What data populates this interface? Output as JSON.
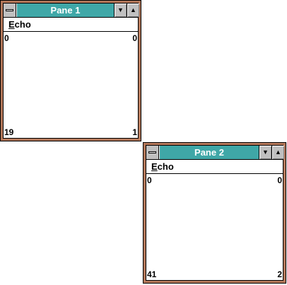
{
  "panes": [
    {
      "title": "Pane 1",
      "menu": {
        "echo_label": "Echo",
        "echo_mnemonic": "E",
        "echo_rest": "cho"
      },
      "values": {
        "top_left": "0",
        "top_right": "0",
        "bottom_left": "19",
        "bottom_right": "1"
      }
    },
    {
      "title": "Pane 2",
      "menu": {
        "echo_label": "Echo",
        "echo_mnemonic": "E",
        "echo_rest": "cho"
      },
      "values": {
        "top_left": "0",
        "top_right": "0",
        "bottom_left": "41",
        "bottom_right": "2"
      }
    }
  ],
  "icons": {
    "system_menu": "system-menu-icon",
    "minimize": "minimize-arrow-icon",
    "maximize": "maximize-arrow-icon"
  },
  "colors": {
    "caption_active": "#3fa7a7",
    "frame": "#b4785a",
    "button_face": "#c0c0c0"
  }
}
